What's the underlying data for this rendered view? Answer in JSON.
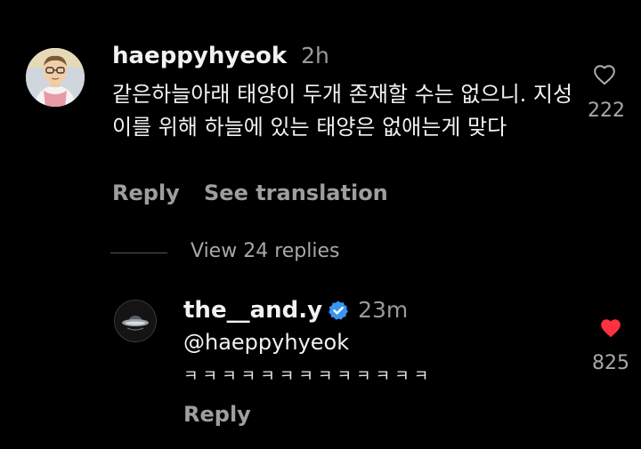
{
  "comment": {
    "username": "haeppyhyeok",
    "time": "2h",
    "text": "같은하늘아래 태양이 두개 존재할 수는 없으니. 지성이를 위해 하늘에 있는 태양은 없애는게 맞다",
    "reply_label": "Reply",
    "translate_label": "See translation",
    "like_count": "222",
    "liked": false,
    "avatar_icon": "cartoon-avatar"
  },
  "view_replies_label": "View 24 replies",
  "reply": {
    "username": "the__and.y",
    "verified": true,
    "time": "23m",
    "mention": "@haeppyhyeok",
    "text": "ㅋㅋㅋㅋㅋㅋㅋㅋㅋㅋㅋㅋㅋ",
    "reply_label": "Reply",
    "like_count": "825",
    "liked": true,
    "avatar_icon": "ufo-avatar"
  },
  "colors": {
    "background": "#000000",
    "primary_text": "#f2f2f2",
    "secondary_text": "#a8a8a8",
    "like_active": "#ff3040",
    "verified_badge": "#3897f0"
  }
}
